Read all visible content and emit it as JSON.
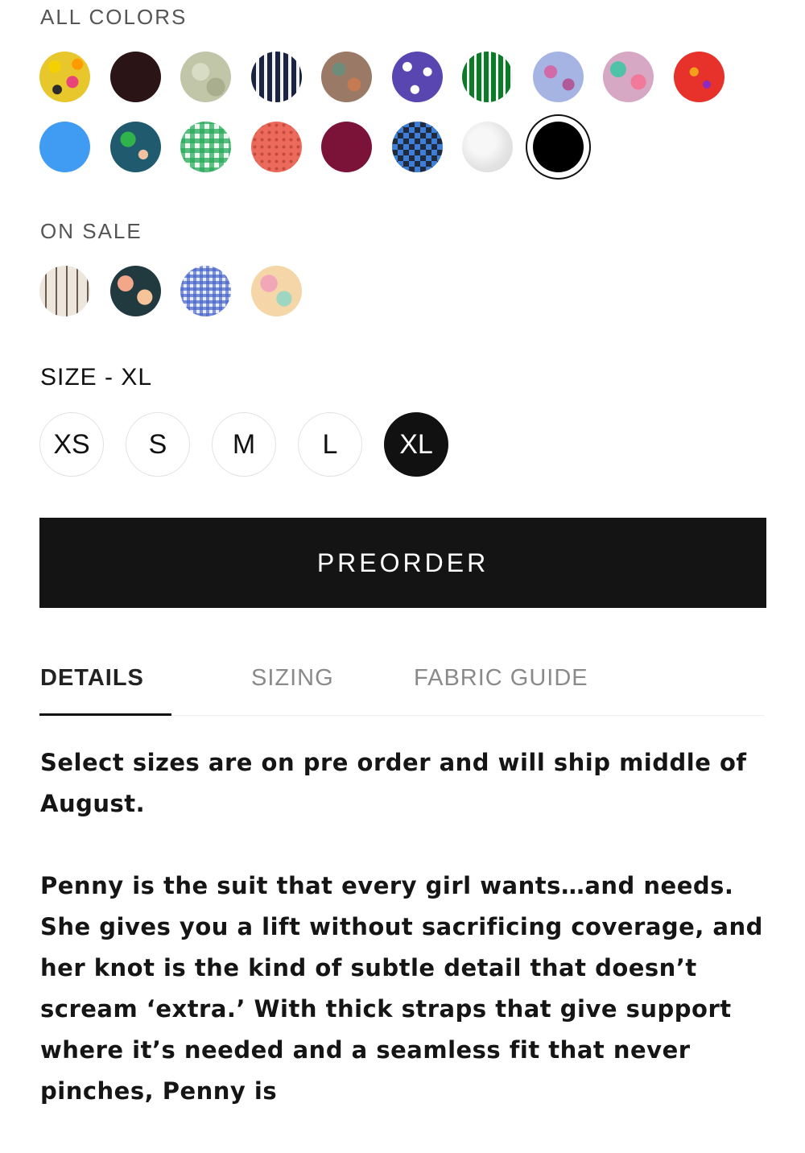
{
  "all_colors": {
    "label": "ALL COLORS",
    "swatches": [
      {
        "name": "yellow-floral",
        "bg": "radial-gradient(circle at 30% 30%, #f4d000 0 12%, transparent 13%), radial-gradient(circle at 65% 60%, #e8457a 0 13%, transparent 14%), radial-gradient(circle at 35% 75%, #2b2b2b 0 9%, transparent 10%), radial-gradient(circle at 75% 25%, #ff9a00 0 10%, transparent 11%), #e8c72c"
      },
      {
        "name": "dark-brown",
        "bg": "#2a1416"
      },
      {
        "name": "sage-texture",
        "bg": "radial-gradient(circle at 40% 40%, #d8dcc4 0 20%, transparent 21%), radial-gradient(circle at 70% 70%, #a9ae8e 0 18%, transparent 19%), #c2c6a8"
      },
      {
        "name": "navy-white-stripe",
        "bg": "repeating-linear-gradient(90deg, #1a2340 0 6px, #f2f2f2 6px 10px)"
      },
      {
        "name": "brown-floral",
        "bg": "radial-gradient(circle at 35% 35%, #6e8c7a 0 14%, transparent 15%), radial-gradient(circle at 65% 65%, #c67a52 0 14%, transparent 15%), #9a7a66"
      },
      {
        "name": "purple-stars",
        "bg": "radial-gradient(circle at 30% 30%, #ffffff 0 9%, transparent 10%), radial-gradient(circle at 70% 40%, #ffffff 0 9%, transparent 10%), radial-gradient(circle at 45% 75%, #ffffff 0 9%, transparent 10%), #5a46b0"
      },
      {
        "name": "green-stripe",
        "bg": "repeating-linear-gradient(90deg, #0d7a2a 0 6px, #f2f2f2 6px 9px)"
      },
      {
        "name": "lavender-floral",
        "bg": "radial-gradient(circle at 35% 40%, #d06aa8 0 14%, transparent 15%), radial-gradient(circle at 70% 65%, #b05a98 0 12%, transparent 13%), #a6b4e4"
      },
      {
        "name": "pastel-tropical",
        "bg": "radial-gradient(circle at 30% 35%, #4fc2a8 0 16%, transparent 17%), radial-gradient(circle at 70% 60%, #f17a9a 0 16%, transparent 17%), #d6a8c4"
      },
      {
        "name": "red-paisley",
        "bg": "radial-gradient(circle at 40% 40%, #f3a11b 0 10%, transparent 11%), radial-gradient(circle at 65% 65%, #8a2ac2 0 8%, transparent 9%), #e6322a"
      },
      {
        "name": "sky-blue",
        "bg": "#3f9cf2"
      },
      {
        "name": "palm-leaf",
        "bg": "radial-gradient(circle at 35% 35%, #2fb34a 0 16%, transparent 17%), radial-gradient(circle at 65% 65%, #f2c2a0 0 10%, transparent 11%), #1f5a6e"
      },
      {
        "name": "green-gingham",
        "bg": "repeating-linear-gradient(0deg, rgba(39,170,90,0.75) 0 6px, transparent 6px 12px), repeating-linear-gradient(90deg, rgba(39,170,90,0.75) 0 6px, #eaf6ee 6px 12px)"
      },
      {
        "name": "coral-dot",
        "bg": "radial-gradient(circle, #c44a3a 1.5px, transparent 2.5px) 0 0 / 9px 9px, #ec6a5c"
      },
      {
        "name": "burgundy",
        "bg": "#7b1238"
      },
      {
        "name": "blue-checker",
        "bg": "repeating-conic-gradient(#1f2a3c 0 25%, #3d7fd8 0 50%) 0 0 / 14px 14px"
      },
      {
        "name": "white-textured",
        "bg": "radial-gradient(circle at 40% 40%, #f7f7f7 0 30%, #e4e4e4 60%, #d6d6d6)"
      },
      {
        "name": "black",
        "bg": "#000000"
      }
    ],
    "selected_index": 17
  },
  "on_sale": {
    "label": "ON SALE",
    "swatches": [
      {
        "name": "ikat-stripe",
        "bg": "repeating-linear-gradient(90deg, #ece6dc 0 7px, #6b5b50 7px 9px, #ece6dc 9px 13px)"
      },
      {
        "name": "navy-peach-floral",
        "bg": "radial-gradient(circle at 30% 35%, #f2a78a 0 16%, transparent 17%), radial-gradient(circle at 68% 62%, #f7c49a 0 16%, transparent 17%), #213a3f"
      },
      {
        "name": "blue-gingham",
        "bg": "repeating-linear-gradient(0deg, rgba(70,100,200,0.7) 0 4px, transparent 4px 8px), repeating-linear-gradient(90deg, rgba(70,100,200,0.7) 0 4px, #e8ecff 4px 8px)"
      },
      {
        "name": "pastel-watercolor",
        "bg": "radial-gradient(circle at 35% 35%, #f2a7b8 0 18%, transparent 19%), radial-gradient(circle at 65% 65%, #9ed6c0 0 16%, transparent 17%), #f4d6a8"
      }
    ]
  },
  "size": {
    "label": "SIZE - XL",
    "options": [
      "XS",
      "S",
      "M",
      "L",
      "XL"
    ],
    "selected": "XL"
  },
  "cta": {
    "label": "PREORDER"
  },
  "tabs": [
    {
      "label": "DETAILS",
      "active": true
    },
    {
      "label": "SIZING",
      "active": false
    },
    {
      "label": "FABRIC GUIDE",
      "active": false
    }
  ],
  "details": {
    "paragraphs": [
      "Select sizes are on pre order and will ship middle of August.",
      "Penny is the suit that every girl wants…and needs. She gives you a lift without sacrificing coverage, and her knot is the kind of subtle detail that doesn’t scream ‘extra.’ With thick straps that give support where it’s needed and a seamless fit that never pinches, Penny is"
    ]
  }
}
